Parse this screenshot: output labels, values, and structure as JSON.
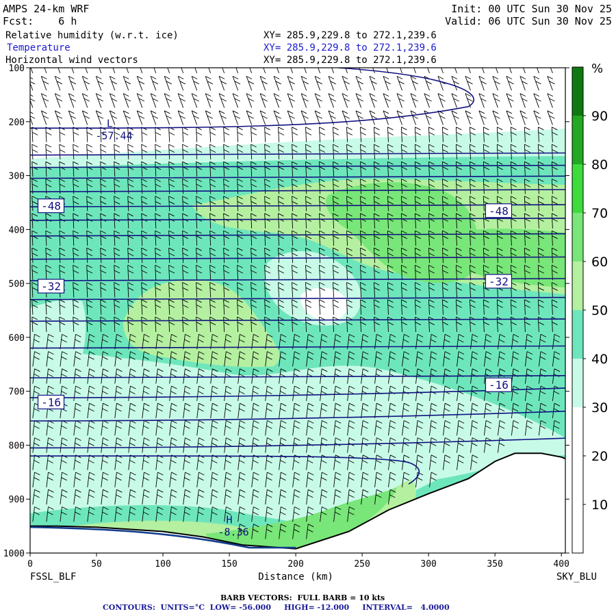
{
  "header": {
    "model": "AMPS 24-km WRF",
    "fcst": "Fcst:    6 h",
    "init": "Init: 00 UTC Sun 30 Nov 25",
    "valid": "Valid: 06 UTC Sun 30 Nov 25",
    "fields": [
      {
        "name": "Relative humidity (w.r.t. ice)",
        "xy": "XY= 285.9,229.8 to 272.1,239.6"
      },
      {
        "name": "Temperature",
        "xy": "XY= 285.9,229.8 to 272.1,239.6"
      },
      {
        "name": "Horizontal wind vectors",
        "xy": "XY= 285.9,229.8 to 272.1,239.6"
      }
    ]
  },
  "footer": {
    "barb_note": "BARB VECTORS:  FULL BARB = 10 kts",
    "contours_note": "CONTOURS:  UNITS=°C  LOW= -56.000     HIGH= -12.000     INTERVAL=   4.0000"
  },
  "chart_data": {
    "type": "heatmap",
    "xlabel": "Distance (km)",
    "x_ticks": [
      0,
      50,
      100,
      150,
      200,
      250,
      300,
      350,
      400
    ],
    "xlim": [
      0,
      403
    ],
    "y_ticks": [
      100,
      200,
      300,
      400,
      500,
      600,
      700,
      800,
      900,
      1000
    ],
    "ylim": [
      100,
      1000
    ],
    "left_endpoint": "FSSL_BLF",
    "right_endpoint": "SKY_BLU",
    "colorbar": {
      "unit": "%",
      "tick_labels": [
        "10",
        "20",
        "30",
        "40",
        "50",
        "60",
        "70",
        "80",
        "90"
      ],
      "bins": [
        0,
        10,
        20,
        30,
        40,
        50,
        60,
        70,
        80,
        90,
        100
      ],
      "colors": [
        "#ffffff",
        "#ffffff",
        "#ffffff",
        "#c8fae8",
        "#6ee6bc",
        "#b4f0a0",
        "#78e678",
        "#3cdc3c",
        "#22a822",
        "#107810"
      ]
    },
    "temperature_contour_labels": [
      {
        "text": "-48",
        "x": 8,
        "p": 356
      },
      {
        "text": "-48",
        "x": 345,
        "p": 365
      },
      {
        "text": "-32",
        "x": 8,
        "p": 505
      },
      {
        "text": "-32",
        "x": 345,
        "p": 496
      },
      {
        "text": "-16",
        "x": 8,
        "p": 720
      },
      {
        "text": "-16",
        "x": 345,
        "p": 688
      }
    ],
    "extrema": [
      {
        "mark": "L",
        "value": "-57.44",
        "x": 60,
        "p": 230
      },
      {
        "mark": "H",
        "value": "-8.36",
        "x": 150,
        "p": 965
      }
    ]
  }
}
